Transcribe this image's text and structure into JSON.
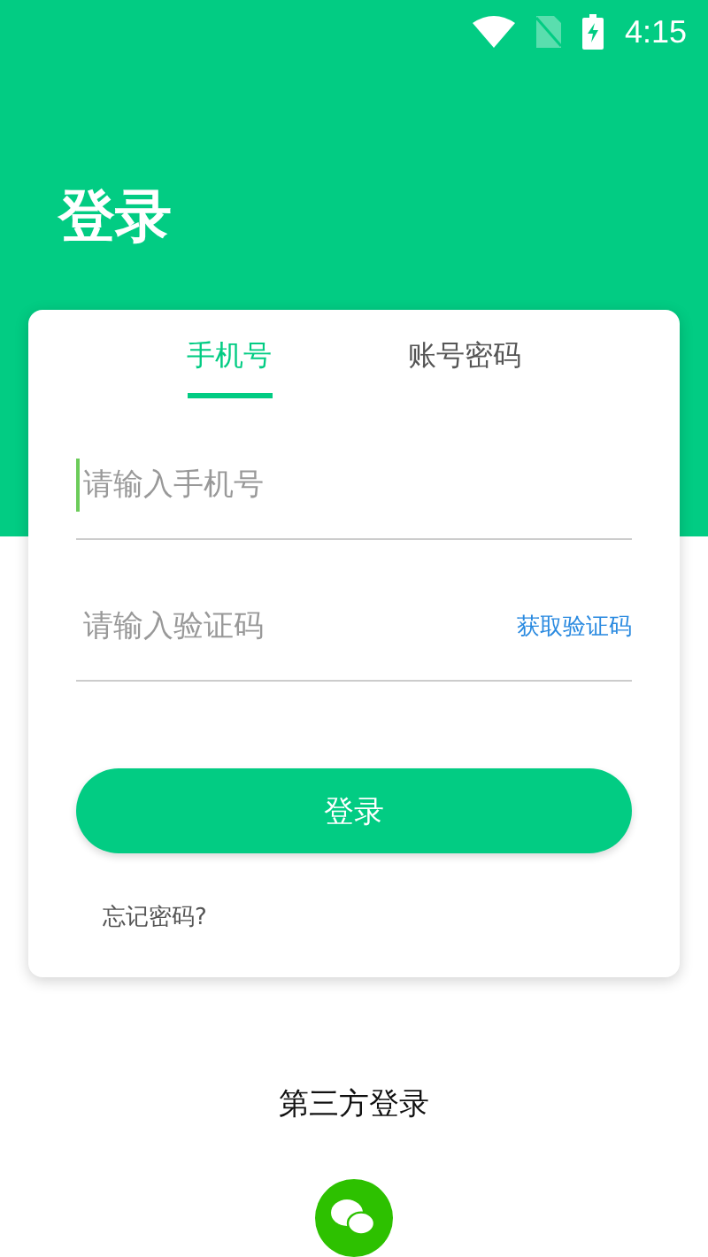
{
  "status_bar": {
    "time": "4:15"
  },
  "title": "登录",
  "tabs": [
    {
      "label": "手机号",
      "selected": true
    },
    {
      "label": "账号密码",
      "selected": false
    }
  ],
  "fields": [
    {
      "placeholder": "请输入手机号",
      "focused": true
    },
    {
      "placeholder": "请输入验证码",
      "action": "获取验证码",
      "focused": false
    }
  ],
  "login_button": "登录",
  "forgot_password": "忘记密码?",
  "third_party": {
    "label": "第三方登录"
  }
}
